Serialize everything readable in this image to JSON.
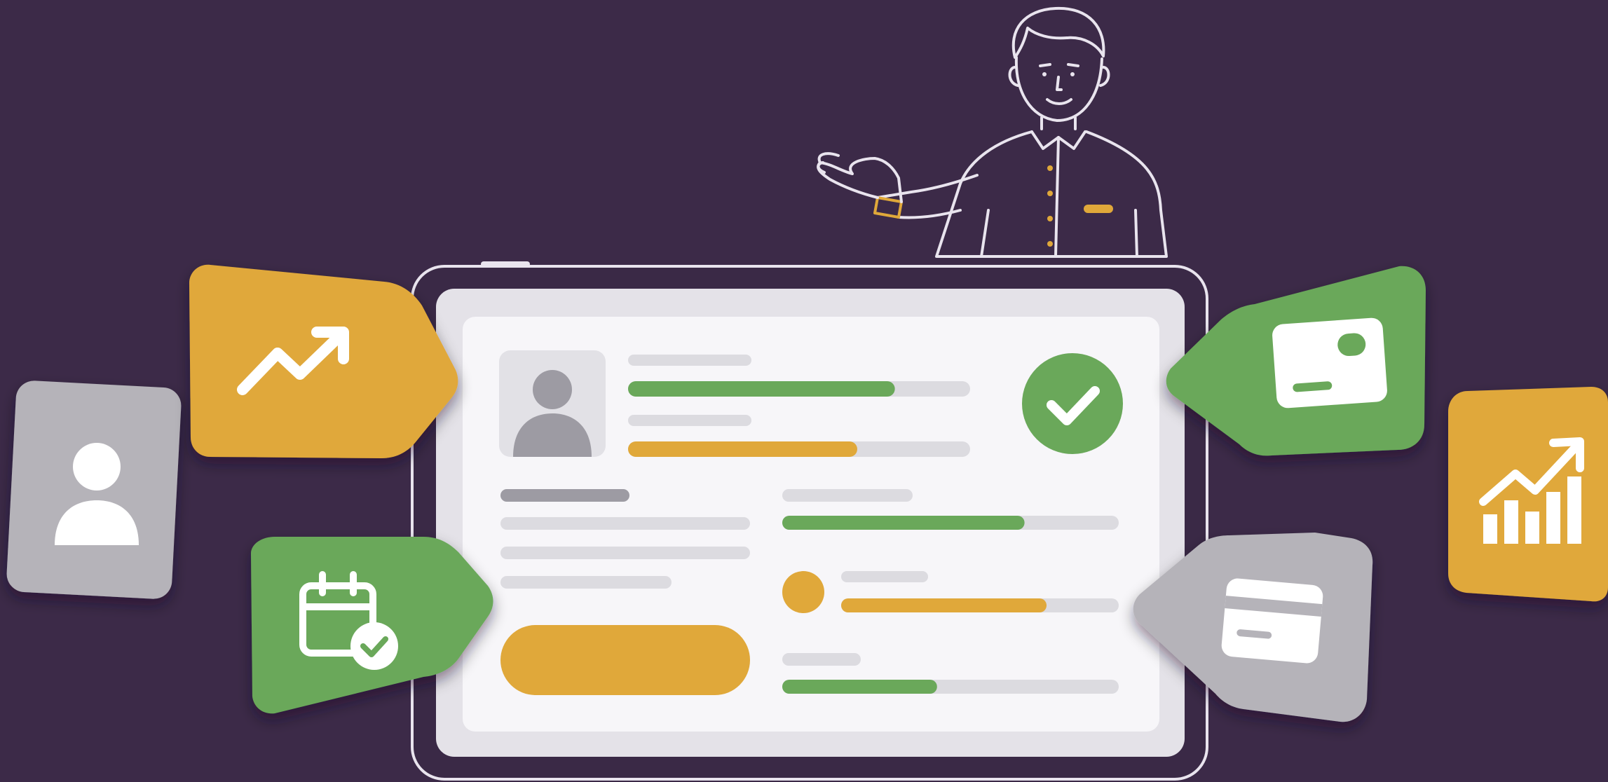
{
  "scene": {
    "colors": {
      "background": "#3c2a48",
      "outline": "#e9e4ee",
      "tablet_frame": "#3a2946",
      "screen_outer": "#e4e2e8",
      "screen_inner": "#f7f6f9",
      "green": "#6aa85a",
      "gold": "#e0a83a",
      "gray_card": "#b5b3b9",
      "placeholder": "#dcdbe0",
      "placeholder_dark": "#9d9ba3",
      "white": "#ffffff"
    },
    "presenter": {
      "figure": "concierge",
      "gesture": "open-hand-presenting"
    },
    "tablet": {
      "profile": {
        "avatar": "person-icon",
        "progress_bars": [
          {
            "color": "green",
            "fill": 0.78
          },
          {
            "color": "gold",
            "fill": 0.67
          }
        ],
        "status": "check-circle-icon"
      },
      "left_column": {
        "text_lines": 4,
        "button": {
          "color": "gold",
          "label": ""
        }
      },
      "right_column": {
        "progress_bars": [
          {
            "color": "green",
            "fill": 0.72
          },
          {
            "color": "gold",
            "fill": 0.74
          },
          {
            "color": "green",
            "fill": 0.46
          }
        ],
        "avatar_dot": "gold"
      }
    },
    "tags": [
      {
        "icon": "user-icon",
        "color": "gray",
        "side": "left"
      },
      {
        "icon": "trending-up-icon",
        "color": "gold",
        "side": "left"
      },
      {
        "icon": "calendar-check-icon",
        "color": "green",
        "side": "left"
      },
      {
        "icon": "id-card-icon",
        "color": "green",
        "side": "right"
      },
      {
        "icon": "credit-card-icon",
        "color": "gray",
        "side": "right"
      },
      {
        "icon": "bar-chart-growth-icon",
        "color": "gold",
        "side": "right"
      }
    ]
  }
}
